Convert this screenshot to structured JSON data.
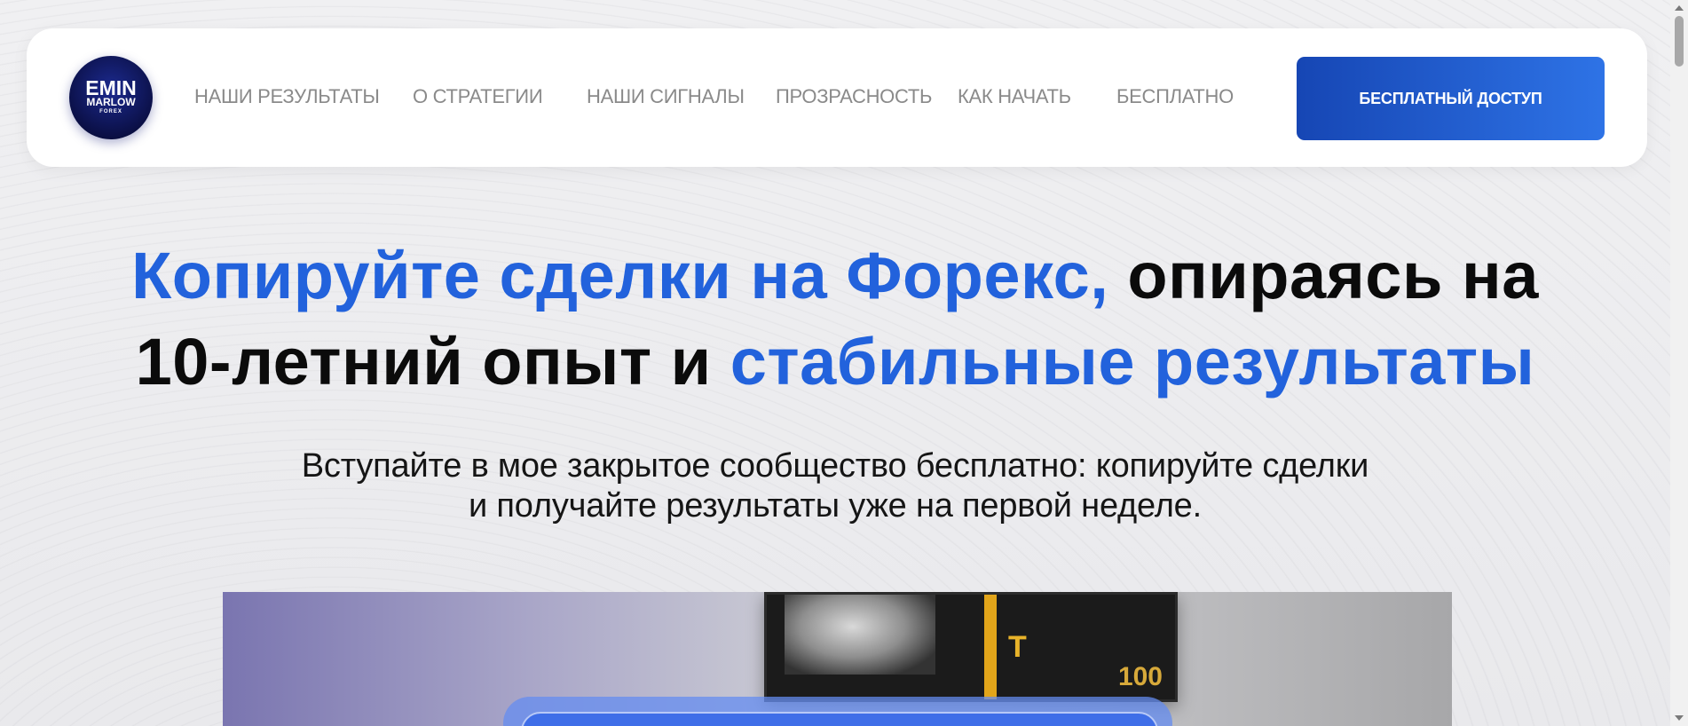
{
  "header": {
    "logo": {
      "line1": "EMIN",
      "line2": "MARLOW",
      "line3": "FOREX"
    },
    "nav": [
      {
        "label": "НАШИ РЕЗУЛЬТАТЫ"
      },
      {
        "label": "О СТРАТЕГИИ"
      },
      {
        "label": "НАШИ СИГНАЛЫ"
      },
      {
        "label": "ПРОЗРАСНОСТЬ"
      },
      {
        "label": "КАК НАЧАТЬ"
      },
      {
        "label": "БЕСПЛАТНО"
      }
    ],
    "cta_label": "БЕСПЛАТНЫЙ ДОСТУП"
  },
  "hero": {
    "title_part1": "Копируйте сделки на Форекс,",
    "title_part2": " опираясь на 10-летний опыт и ",
    "title_part3": "стабильные результаты",
    "subtitle": "Вступайте в мое закрытое сообщество бесплатно: копируйте сделки и получайте результаты уже на первой неделе."
  },
  "video": {
    "bill_glyph": "T",
    "bill_number": "100"
  },
  "colors": {
    "accent_blue": "#2262dc",
    "cta_start": "#1646b4",
    "cta_end": "#2e73e6",
    "nav_text": "#8a8a8a"
  }
}
